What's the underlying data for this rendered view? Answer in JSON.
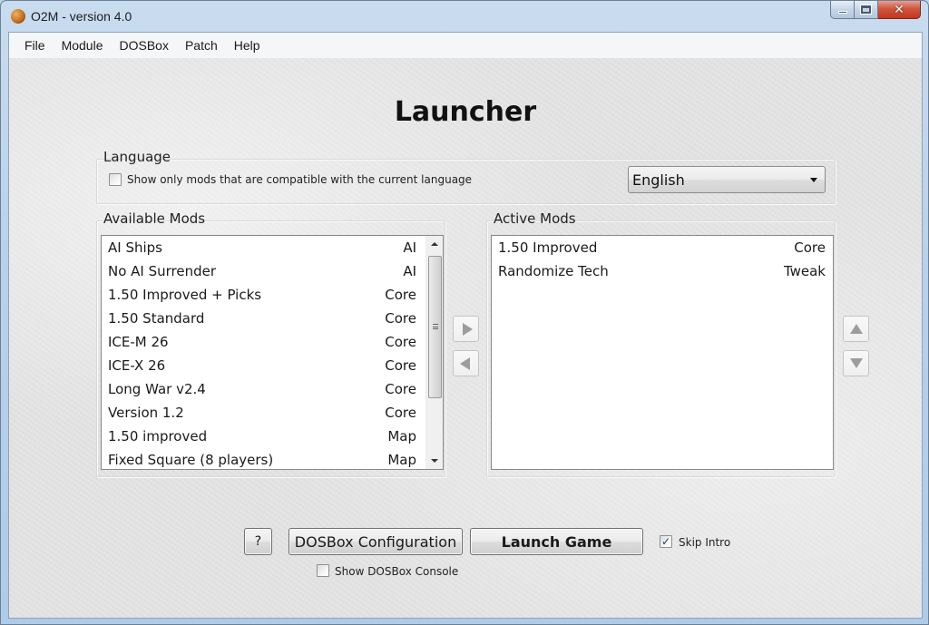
{
  "window": {
    "title": "O2M - version 4.0",
    "app_icon": "planet-icon",
    "controls": {
      "minimize": "minimize-icon",
      "maximize": "maximize-icon",
      "close_glyph": "✕"
    }
  },
  "menubar": {
    "items": [
      {
        "label": "File"
      },
      {
        "label": "Module"
      },
      {
        "label": "DOSBox"
      },
      {
        "label": "Patch"
      },
      {
        "label": "Help"
      }
    ]
  },
  "heading": "Launcher",
  "language": {
    "group_label": "Language",
    "compat_checkbox": {
      "label": "Show only mods that are compatible with the current language",
      "checked": false
    },
    "selected": "English"
  },
  "available_mods": {
    "group_label": "Available Mods",
    "items": [
      {
        "name": "AI Ships",
        "type": "AI"
      },
      {
        "name": "No AI Surrender",
        "type": "AI"
      },
      {
        "name": "1.50 Improved + Picks",
        "type": "Core"
      },
      {
        "name": "1.50 Standard",
        "type": "Core"
      },
      {
        "name": "ICE-M 26",
        "type": "Core"
      },
      {
        "name": "ICE-X 26",
        "type": "Core"
      },
      {
        "name": "Long War v2.4",
        "type": "Core"
      },
      {
        "name": "Version 1.2",
        "type": "Core"
      },
      {
        "name": "1.50 improved",
        "type": "Map"
      },
      {
        "name": "Fixed Square (8 players)",
        "type": "Map"
      }
    ]
  },
  "active_mods": {
    "group_label": "Active Mods",
    "items": [
      {
        "name": "1.50 Improved",
        "type": "Core"
      },
      {
        "name": "Randomize Tech",
        "type": "Tweak"
      }
    ]
  },
  "buttons": {
    "help": "?",
    "dosbox_config": "DOSBox Configuration",
    "launch": "Launch Game"
  },
  "skip_intro": {
    "label": "Skip Intro",
    "checked": true,
    "check_glyph": "✓"
  },
  "show_console": {
    "label": "Show DOSBox Console",
    "checked": false
  }
}
